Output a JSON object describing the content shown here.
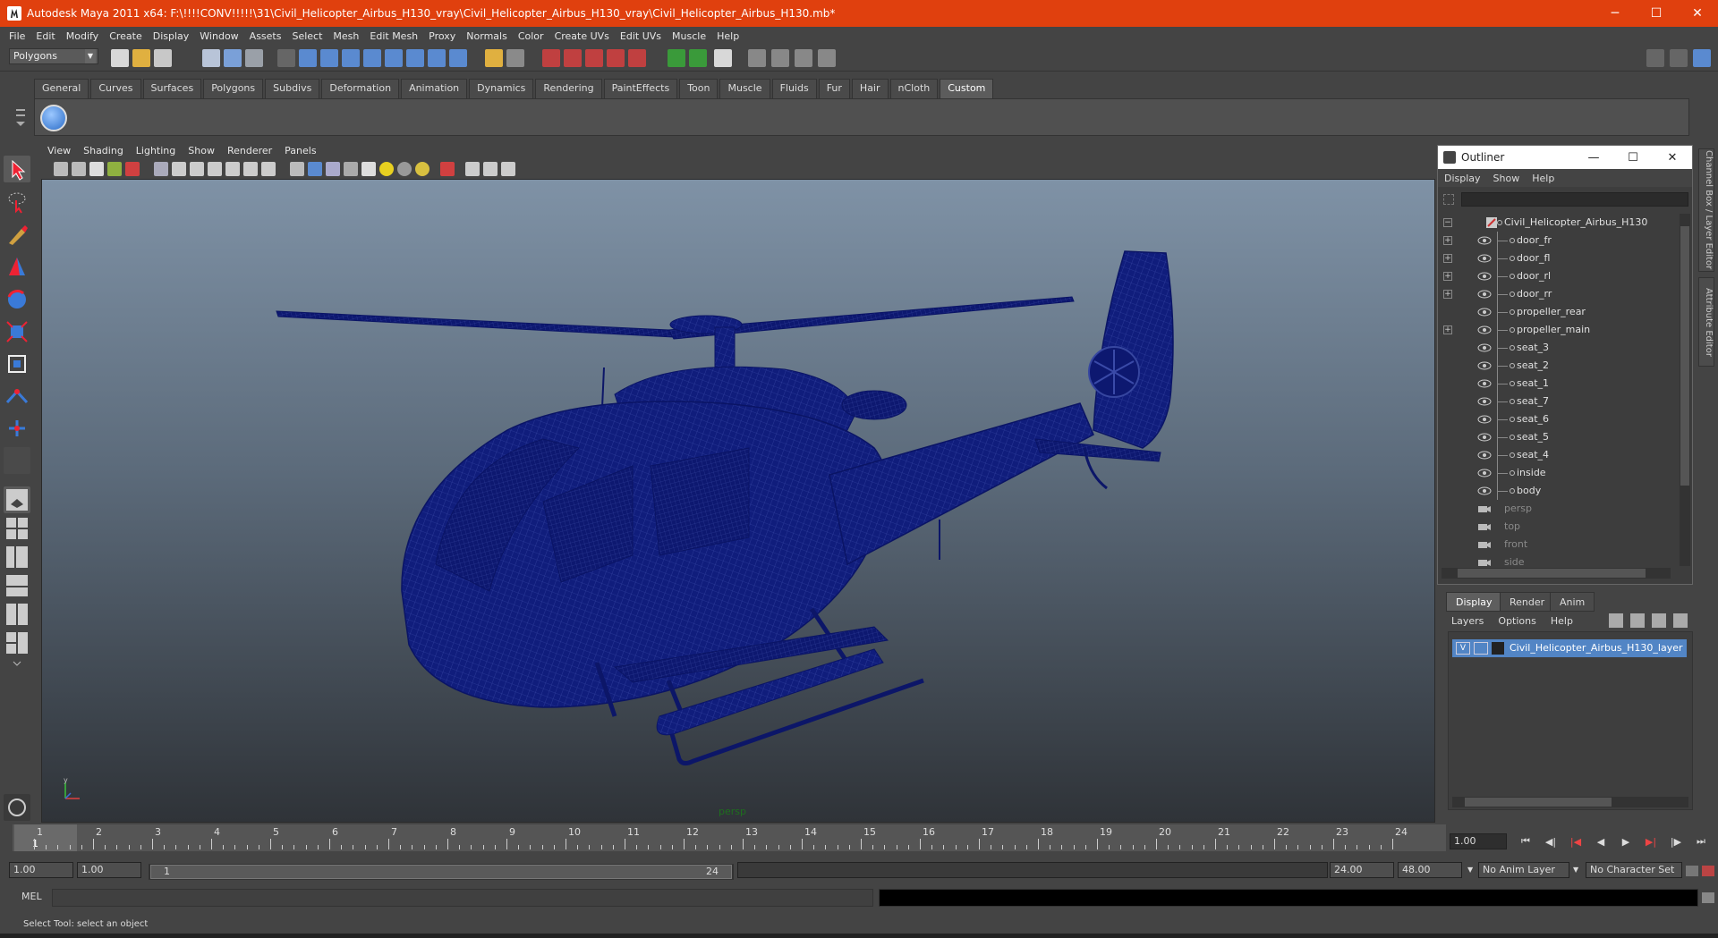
{
  "window": {
    "title": "Autodesk Maya 2011 x64: F:\\!!!!CONV!!!!!\\31\\Civil_Helicopter_Airbus_H130_vray\\Civil_Helicopter_Airbus_H130_vray\\Civil_Helicopter_Airbus_H130.mb*",
    "minimize": "─",
    "maximize": "☐",
    "close": "✕"
  },
  "menubar": [
    "File",
    "Edit",
    "Modify",
    "Create",
    "Display",
    "Window",
    "Assets",
    "Select",
    "Mesh",
    "Edit Mesh",
    "Proxy",
    "Normals",
    "Color",
    "Create UVs",
    "Edit UVs",
    "Muscle",
    "Help"
  ],
  "statusline": {
    "mode": "Polygons"
  },
  "shelf": {
    "tabs": [
      "General",
      "Curves",
      "Surfaces",
      "Polygons",
      "Subdivs",
      "Deformation",
      "Animation",
      "Dynamics",
      "Rendering",
      "PaintEffects",
      "Toon",
      "Muscle",
      "Fluids",
      "Fur",
      "Hair",
      "nCloth",
      "Custom"
    ],
    "active_tab": "Custom"
  },
  "viewport": {
    "menus": [
      "View",
      "Shading",
      "Lighting",
      "Show",
      "Renderer",
      "Panels"
    ],
    "camera_label": "persp",
    "wire_color": "#0f1a7a"
  },
  "outliner": {
    "title": "Outliner",
    "menus": [
      "Display",
      "Show",
      "Help"
    ],
    "root": "Civil_Helicopter_Airbus_H130",
    "items": [
      {
        "name": "door_fr",
        "expandable": true
      },
      {
        "name": "door_fl",
        "expandable": true
      },
      {
        "name": "door_rl",
        "expandable": true
      },
      {
        "name": "door_rr",
        "expandable": true
      },
      {
        "name": "propeller_rear",
        "expandable": false
      },
      {
        "name": "propeller_main",
        "expandable": true
      },
      {
        "name": "seat_3",
        "expandable": false
      },
      {
        "name": "seat_2",
        "expandable": false
      },
      {
        "name": "seat_1",
        "expandable": false
      },
      {
        "name": "seat_7",
        "expandable": false
      },
      {
        "name": "seat_6",
        "expandable": false
      },
      {
        "name": "seat_5",
        "expandable": false
      },
      {
        "name": "seat_4",
        "expandable": false
      },
      {
        "name": "inside",
        "expandable": false
      },
      {
        "name": "body",
        "expandable": false
      }
    ],
    "cameras": [
      "persp",
      "top",
      "front",
      "side"
    ]
  },
  "side_tabs": [
    "Channel Box / Layer Editor",
    "Attribute Editor"
  ],
  "layer_editor": {
    "tabs": [
      "Display",
      "Render",
      "Anim"
    ],
    "active_tab": "Display",
    "menus": [
      "Layers",
      "Options",
      "Help"
    ],
    "layer": {
      "visible": "V",
      "name": "Civil_Helicopter_Airbus_H130_layer"
    }
  },
  "timeline": {
    "ticks": [
      "1",
      "2",
      "3",
      "4",
      "5",
      "6",
      "7",
      "8",
      "9",
      "10",
      "11",
      "12",
      "13",
      "14",
      "15",
      "16",
      "17",
      "18",
      "19",
      "20",
      "21",
      "22",
      "23",
      "24"
    ],
    "current_frame": "1",
    "current_time_field": "1.00"
  },
  "range": {
    "start_time": "1.00",
    "playback_start": "1.00",
    "slider_start": "1",
    "slider_end": "24",
    "playback_end": "24.00",
    "end_time": "48.00",
    "anim_layer": "No Anim Layer",
    "character_set": "No Character Set"
  },
  "command": {
    "label": "MEL"
  },
  "helpline": "Select Tool: select an object"
}
